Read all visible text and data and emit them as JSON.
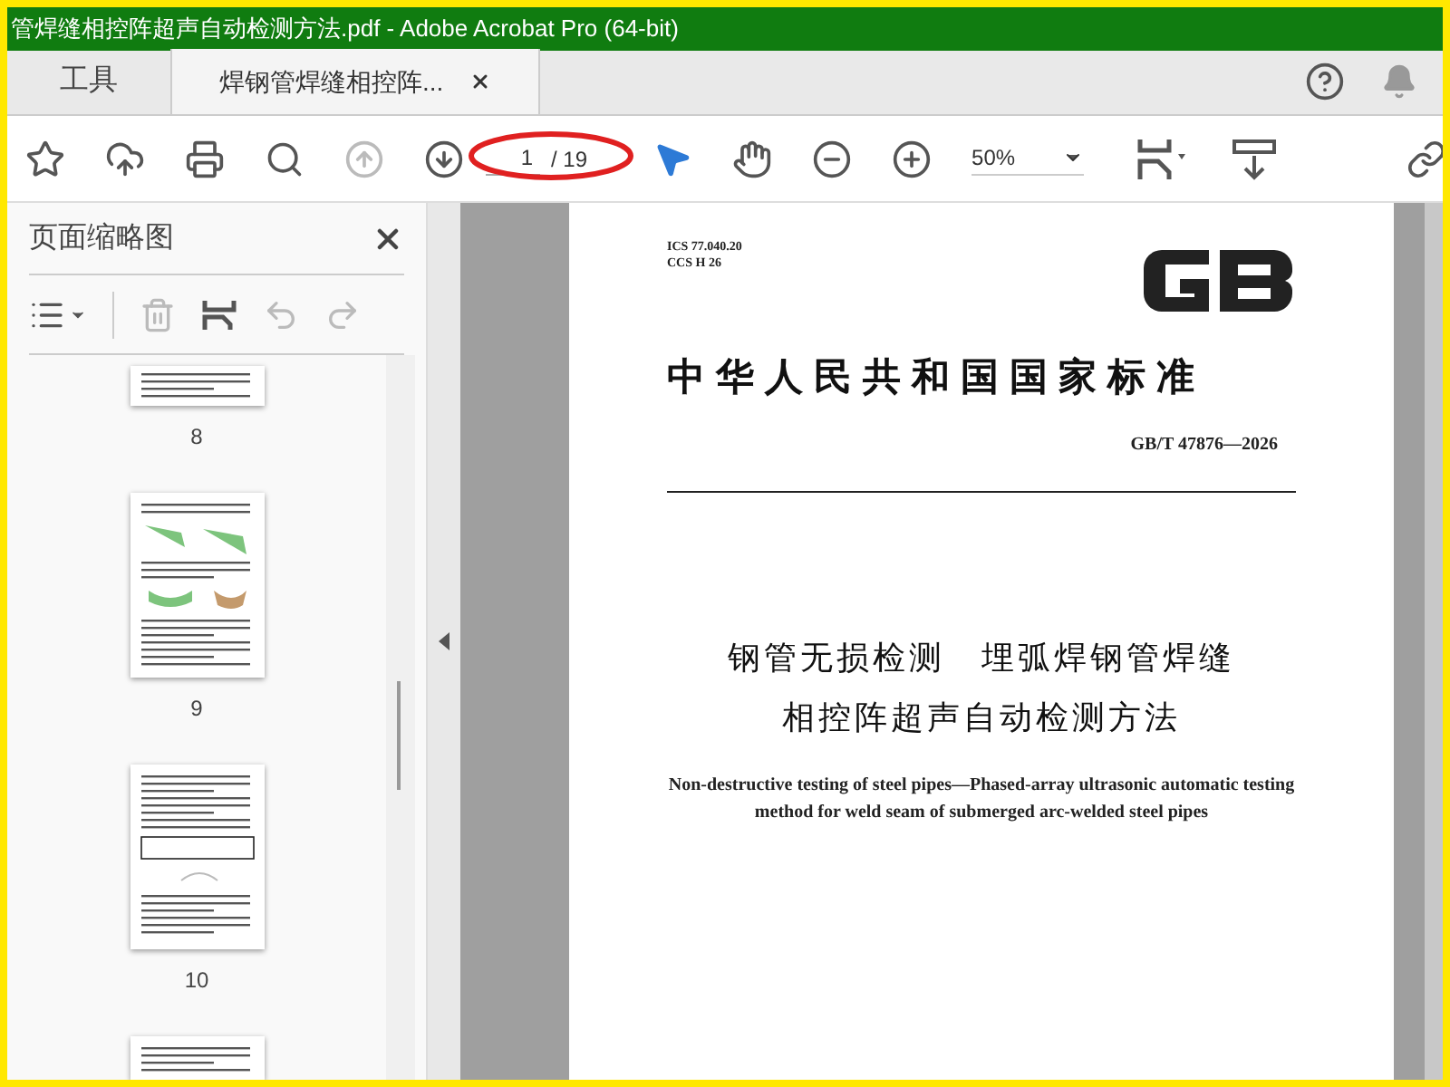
{
  "window": {
    "title": "管焊缝相控阵超声自动检测方法.pdf - Adobe Acrobat Pro (64-bit)"
  },
  "tabs": [
    {
      "label": "工具",
      "selected": false
    },
    {
      "label": "焊钢管焊缝相控阵...",
      "selected": true
    }
  ],
  "toolbar": {
    "page_field": {
      "value": "1",
      "total": "/ 19"
    },
    "zoom": {
      "value": "50%"
    }
  },
  "sidebar": {
    "title": "页面缩略图",
    "thumbnails": [
      {
        "label": "8",
        "kind": "partial-top"
      },
      {
        "label": "9",
        "kind": "figures"
      },
      {
        "label": "10",
        "kind": "table"
      },
      {
        "kind": "partial-bottom"
      }
    ]
  },
  "document": {
    "codes": [
      "ICS 77.040.20",
      "CCS H 26"
    ],
    "heading": "中华人民共和国国家标准",
    "number": "GB/T 47876—2026",
    "title_lines": [
      "钢管无损检测　埋弧焊钢管焊缝",
      "相控阵超声自动检测方法"
    ],
    "english_title": "Non-destructive testing of steel pipes—Phased-array ultrasonic automatic testing method for weld seam of submerged arc-welded steel pipes"
  }
}
